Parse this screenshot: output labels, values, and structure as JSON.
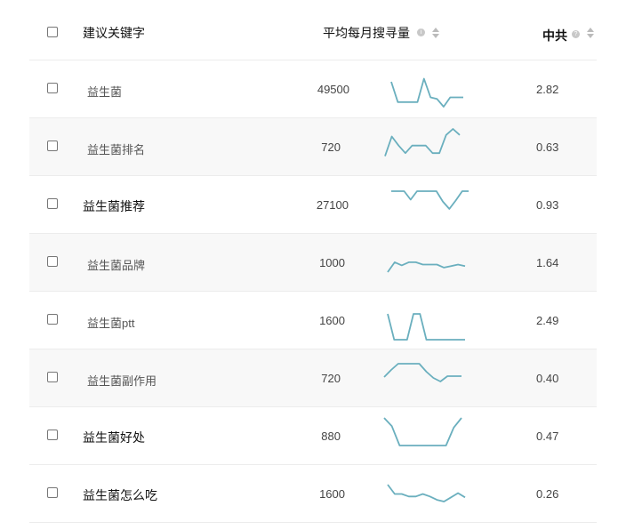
{
  "header": {
    "keyword_label": "建议关键字",
    "volume_label": "平均每月搜寻量",
    "competition_label": "中共"
  },
  "colors": {
    "sparkline": "#6aafbe"
  },
  "rows": [
    {
      "keyword": "益生菌",
      "volume": "49500",
      "competition": "2.82",
      "trend": [
        0.2,
        0.85,
        0.85,
        0.85,
        0.85,
        0.1,
        0.7,
        0.75,
        1.0,
        0.7,
        0.7,
        0.7
      ]
    },
    {
      "keyword": "益生菌排名",
      "volume": "720",
      "competition": "0.63",
      "trend": [
        0.9,
        0.25,
        0.55,
        0.8,
        0.55,
        0.55,
        0.55,
        0.8,
        0.8,
        0.2,
        0.0,
        0.2
      ]
    },
    {
      "keyword": "益生菌推荐",
      "volume": "27100",
      "competition": "0.93",
      "trend": [
        0.0,
        0.0,
        0.0,
        0.45,
        0.0,
        0.0,
        0.0,
        0.0,
        0.55,
        0.95,
        0.5,
        0.0,
        0.0
      ]
    },
    {
      "keyword": "益生菌品牌",
      "volume": "1000",
      "competition": "1.64",
      "trend": [
        1.0,
        0.35,
        0.55,
        0.35,
        0.35,
        0.5,
        0.5,
        0.5,
        0.7,
        0.6,
        0.5,
        0.6
      ]
    },
    {
      "keyword": "益生菌ptt",
      "volume": "1600",
      "competition": "2.49",
      "trend": [
        0.0,
        1.0,
        1.0,
        1.0,
        0.0,
        0.0,
        1.0,
        1.0,
        1.0,
        1.0,
        1.0,
        1.0,
        1.0
      ]
    },
    {
      "keyword": "益生菌副作用",
      "volume": "720",
      "competition": "0.40",
      "trend": [
        0.75,
        0.35,
        0.0,
        0.0,
        0.0,
        0.0,
        0.45,
        0.8,
        1.0,
        0.7,
        0.7,
        0.7
      ]
    },
    {
      "keyword": "益生菌好处",
      "volume": "880",
      "competition": "0.47",
      "trend": [
        0.0,
        0.3,
        1.0,
        1.0,
        1.0,
        1.0,
        1.0,
        1.0,
        1.0,
        0.35,
        0.0
      ]
    },
    {
      "keyword": "益生菌怎么吃",
      "volume": "1600",
      "competition": "0.26",
      "trend": [
        0.0,
        0.55,
        0.55,
        0.7,
        0.7,
        0.55,
        0.7,
        0.9,
        1.0,
        0.75,
        0.5,
        0.75
      ]
    }
  ]
}
